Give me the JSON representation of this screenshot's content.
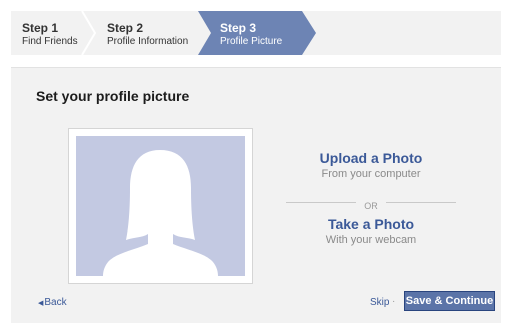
{
  "steps": [
    {
      "title": "Step 1",
      "subtitle": "Find Friends"
    },
    {
      "title": "Step 2",
      "subtitle": "Profile Information"
    },
    {
      "title": "Step 3",
      "subtitle": "Profile Picture"
    }
  ],
  "active_step": 3,
  "main": {
    "title": "Set your profile picture",
    "upload": {
      "title": "Upload a Photo",
      "subtitle": "From your computer"
    },
    "separator": "OR",
    "take": {
      "title": "Take a Photo",
      "subtitle": "With your webcam"
    }
  },
  "footer": {
    "back_label": "Back",
    "skip_label": "Skip",
    "separator": "·",
    "save_label": "Save & Continue"
  },
  "colors": {
    "accent": "#3b5998",
    "active_step": "#6d84b4",
    "button": "#5b74a8",
    "placeholder": "#c3c9e2"
  }
}
